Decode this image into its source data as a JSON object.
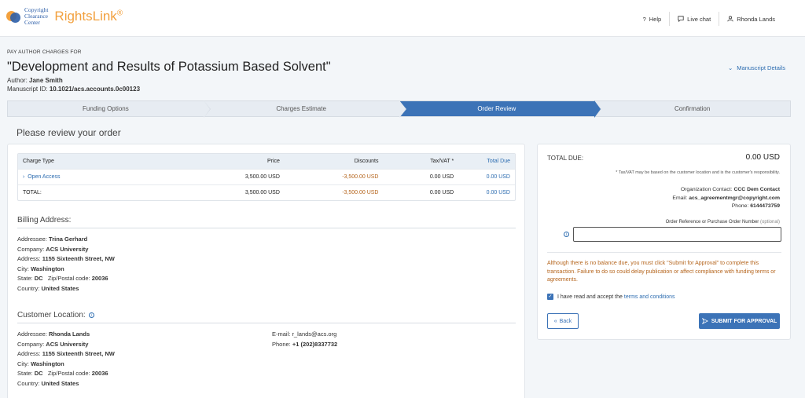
{
  "header": {
    "logo_line1": "Copyright",
    "logo_line2": "Clearance",
    "logo_line3": "Center",
    "brand": "RightsLink",
    "brand_mark": "®",
    "help": "Help",
    "live_chat": "Live chat",
    "user": "Rhonda Lands"
  },
  "page": {
    "pay_label": "PAY AUTHOR CHARGES FOR",
    "title": "\"Development and Results of Potassium Based Solvent\"",
    "author_label": "Author:",
    "author": "Jane Smith",
    "ms_id_label": "Manuscript ID:",
    "ms_id": "10.1021/acs.accounts.0c00123",
    "ms_details": "Manuscript Details",
    "review_heading": "Please review your order"
  },
  "steps": [
    {
      "label": "Funding Options"
    },
    {
      "label": "Charges Estimate"
    },
    {
      "label": "Order Review"
    },
    {
      "label": "Confirmation"
    }
  ],
  "charges": {
    "headers": [
      "Charge Type",
      "Price",
      "Discounts",
      "Tax/VAT",
      "Total Due"
    ],
    "tax_asterisk": "*",
    "rows": [
      {
        "type": "Open Access",
        "price": "3,500.00 USD",
        "discount": "-3,500.00 USD",
        "tax": "0.00 USD",
        "total": "0.00 USD"
      }
    ],
    "total_row": {
      "type": "TOTAL:",
      "price": "3,500.00 USD",
      "discount": "-3,500.00 USD",
      "tax": "0.00 USD",
      "total": "0.00 USD"
    }
  },
  "billing": {
    "title": "Billing Address:",
    "addressee_label": "Addressee:",
    "addressee": "Trina Gerhard",
    "company_label": "Company:",
    "company": "ACS University",
    "address_label": "Address:",
    "address": "1155 Sixteenth Street, NW",
    "city_label": "City:",
    "city": "Washington",
    "state_label": "State:",
    "state": "DC",
    "zip_label": "Zip/Postal code:",
    "zip": "20036",
    "country_label": "Country:",
    "country": "United States"
  },
  "customer": {
    "title": "Customer Location:",
    "addressee_label": "Addressee:",
    "addressee": "Rhonda Lands",
    "company_label": "Company:",
    "company": "ACS University",
    "address_label": "Address:",
    "address": "1155 Sixteenth Street, NW",
    "city_label": "City:",
    "city": "Washington",
    "state_label": "State:",
    "state": "DC",
    "zip_label": "Zip/Postal code:",
    "zip": "20036",
    "country_label": "Country:",
    "country": "United States",
    "email_label": "E-mail:",
    "email": "r_lands@acs.org",
    "phone_label": "Phone:",
    "phone": "+1 (202)8337732"
  },
  "summary": {
    "total_due_label": "TOTAL DUE:",
    "total_due": "0.00 USD",
    "tax_note": "* Tax/VAT may be based on the customer location and is the customer's responsibility.",
    "org_contact_label": "Organization Contact:",
    "org_contact": "CCC Dem Contact",
    "email_label": "Email:",
    "email": "acs_agreementmgr@copyright.com",
    "phone_label": "Phone:",
    "phone": "6144473759",
    "po_label": "Order Reference or Purchase Order Number",
    "po_optional": "(optional)",
    "po_value": "",
    "warning": "Although there is no balance due, you must click \"Submit for Approval\" to complete this transaction. Failure to do so could delay publication or affect compliance with funding terms or agreements.",
    "accept_text": "I have read and accept the",
    "terms_link": "terms and conditions",
    "back": "Back",
    "submit": "SUBMIT FOR APPROVAL"
  },
  "colors": {
    "accent": "#3c73b7",
    "brand_orange": "#f2a03d",
    "warning": "#b5651d"
  }
}
